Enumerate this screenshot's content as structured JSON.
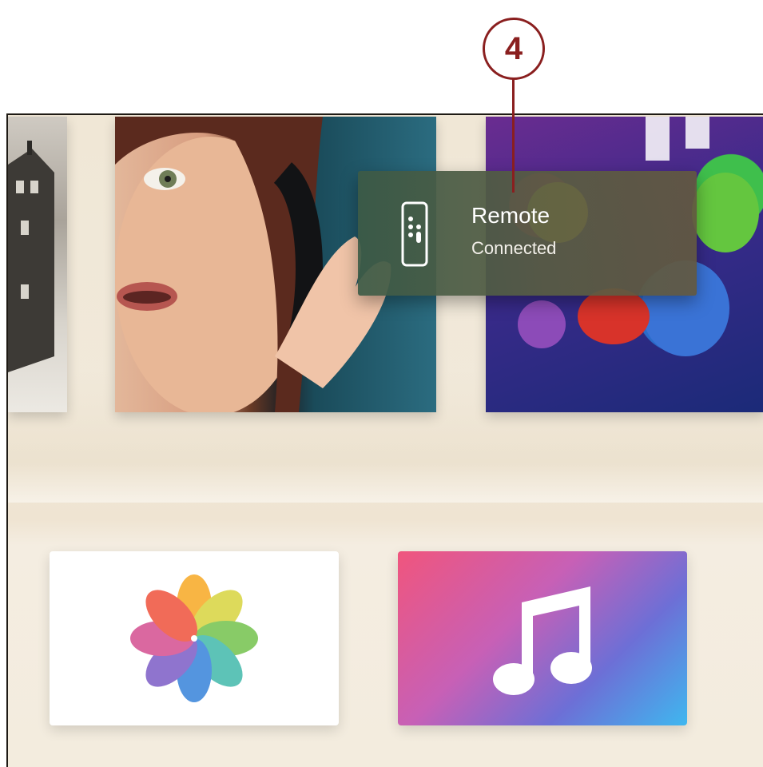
{
  "callout": {
    "number": "4"
  },
  "notification": {
    "title": "Remote",
    "subtitle": "Connected",
    "icon": "remote-icon"
  },
  "top_shelf": {
    "items": [
      "house-drawing-poster",
      "woman-headphones-poster",
      "animated-movie-poster"
    ]
  },
  "apps": [
    {
      "name": "Photos",
      "icon": "photos-flower-icon"
    },
    {
      "name": "Music",
      "icon": "music-note-icon"
    }
  ],
  "colors": {
    "callout": "#8a1f1f",
    "toast": "#5a5c42",
    "photos_tile": "#ffffff",
    "music_pink": "#f0557d",
    "music_blue": "#3fb7ef"
  }
}
